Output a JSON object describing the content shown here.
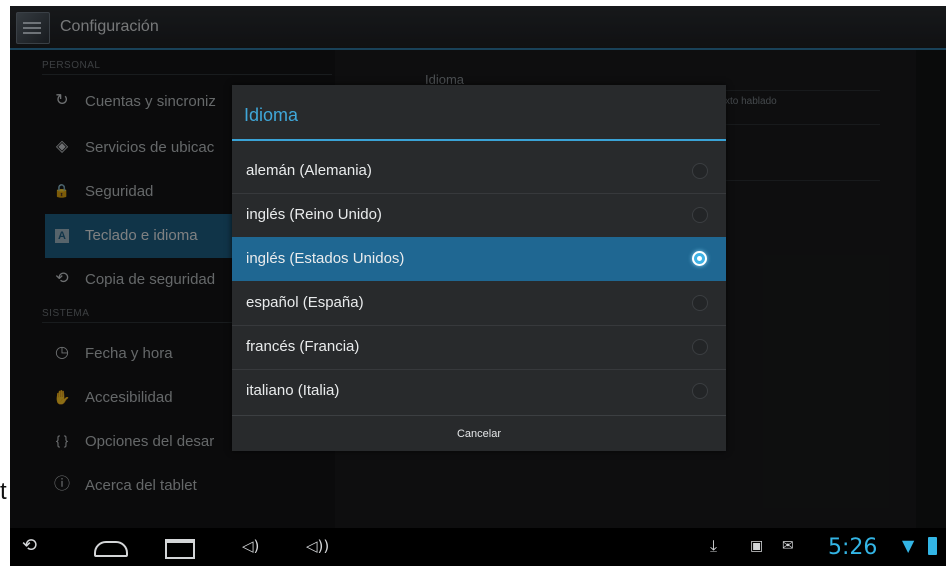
{
  "stray_char": "t",
  "actionbar": {
    "title": "Configuración",
    "icon": "settings-app-icon"
  },
  "left_pane": {
    "sections": [
      {
        "header": "PERSONAL"
      },
      {
        "header": "SISTEMA"
      }
    ],
    "items": [
      {
        "label": "Cuentas y sincroniz",
        "icon": "sync-icon",
        "glyph": "↻"
      },
      {
        "label": "Servicios de ubicac",
        "icon": "location-icon",
        "glyph": "◈"
      },
      {
        "label": "Seguridad",
        "icon": "lock-icon",
        "glyph": "🔒"
      },
      {
        "label": "Teclado e idioma",
        "icon": "keyboard-icon",
        "glyph": "A"
      },
      {
        "label": "Copia de seguridad",
        "icon": "backup-icon",
        "glyph": "⟲"
      },
      {
        "label": "Fecha y hora",
        "icon": "clock-icon",
        "glyph": "◷"
      },
      {
        "label": "Accesibilidad",
        "icon": "hand-icon",
        "glyph": "✋"
      },
      {
        "label": "Opciones del desar",
        "icon": "braces-icon",
        "glyph": "{ }"
      },
      {
        "label": "Acerca del tablet",
        "icon": "info-icon",
        "glyph": "ⓘ"
      }
    ]
  },
  "right_pane": {
    "header": "Idioma",
    "subtext": "xto hablado"
  },
  "dialog": {
    "title": "Idioma",
    "options": [
      {
        "label": "alemán (Alemania)",
        "selected": false
      },
      {
        "label": "inglés (Reino Unido)",
        "selected": false
      },
      {
        "label": "inglés (Estados Unidos)",
        "selected": true
      },
      {
        "label": "español (España)",
        "selected": false
      },
      {
        "label": "francés (Francia)",
        "selected": false
      },
      {
        "label": "italiano (Italia)",
        "selected": false
      }
    ],
    "cancel_label": "Cancelar"
  },
  "system_bar": {
    "clock": "5:26",
    "accent_color": "#33b5e5"
  }
}
